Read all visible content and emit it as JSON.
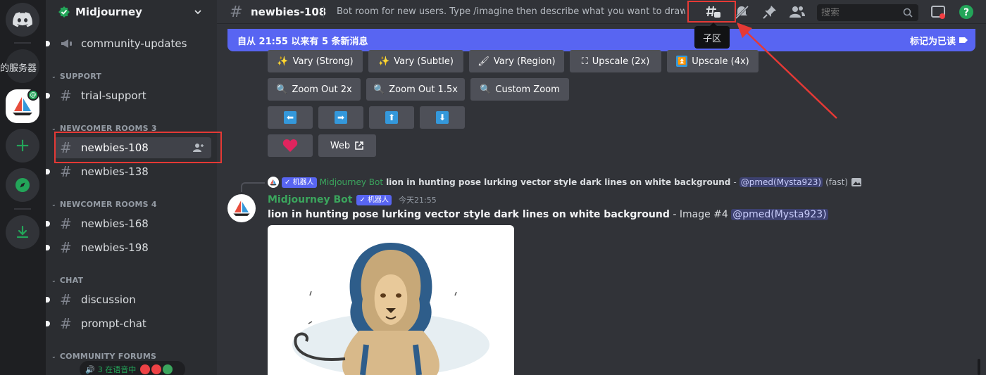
{
  "rail": {
    "server_label": "的服务器"
  },
  "sidebar": {
    "server_name": "Midjourney",
    "items": [
      {
        "type": "channel",
        "label": "community-updates",
        "icon": "megaphone-icon"
      },
      {
        "type": "category",
        "label": "SUPPORT"
      },
      {
        "type": "channel",
        "label": "trial-support",
        "icon": "hash-icon"
      },
      {
        "type": "category",
        "label": "NEWCOMER ROOMS 3"
      },
      {
        "type": "channel",
        "label": "newbies-108",
        "icon": "thread-hash-icon",
        "active": true
      },
      {
        "type": "channel",
        "label": "newbies-138",
        "icon": "thread-hash-icon"
      },
      {
        "type": "category",
        "label": "NEWCOMER ROOMS 4"
      },
      {
        "type": "channel",
        "label": "newbies-168",
        "icon": "thread-hash-icon"
      },
      {
        "type": "channel",
        "label": "newbies-198",
        "icon": "thread-hash-icon"
      },
      {
        "type": "category",
        "label": "CHAT"
      },
      {
        "type": "channel",
        "label": "discussion",
        "icon": "thread-hash-icon"
      },
      {
        "type": "channel",
        "label": "prompt-chat",
        "icon": "thread-hash-icon"
      },
      {
        "type": "category",
        "label": "COMMUNITY FORUMS"
      }
    ],
    "voice_status": "3 在语音中"
  },
  "header": {
    "title": "newbies-108",
    "topic": "Bot room for new users. Type /imagine then describe what you want to draw. See h...",
    "search_placeholder": "搜索",
    "tooltip": "子区"
  },
  "banner": {
    "text": "自从 21:55 以来有 5 条新消息",
    "mark_read": "标记为已读"
  },
  "buttons": {
    "vary_strong": "Vary (Strong)",
    "vary_subtle": "Vary (Subtle)",
    "vary_region": "Vary (Region)",
    "upscale_2x": "Upscale (2x)",
    "upscale_4x": "Upscale (4x)",
    "zoom_out_2x": "Zoom Out 2x",
    "zoom_out_15x": "Zoom Out 1.5x",
    "custom_zoom": "Custom Zoom",
    "web": "Web"
  },
  "reply": {
    "bot_tag": "机器人",
    "author": "Midjourney Bot",
    "prompt": "lion in hunting pose lurking vector style dark lines on white background",
    "sep": "-",
    "mention": "@pmed(Mysta923)",
    "mode": "(fast)"
  },
  "message": {
    "author": "Midjourney Bot",
    "bot_tag": "机器人",
    "time": "今天21:55",
    "prompt": "lion in hunting pose lurking vector style dark lines on white background",
    "suffix": "- Image #4",
    "mention": "@pmed(Mysta923)"
  },
  "colors": {
    "accent": "#5865f2",
    "bot_name": "#3ba55d",
    "highlight_box": "#e53935"
  }
}
